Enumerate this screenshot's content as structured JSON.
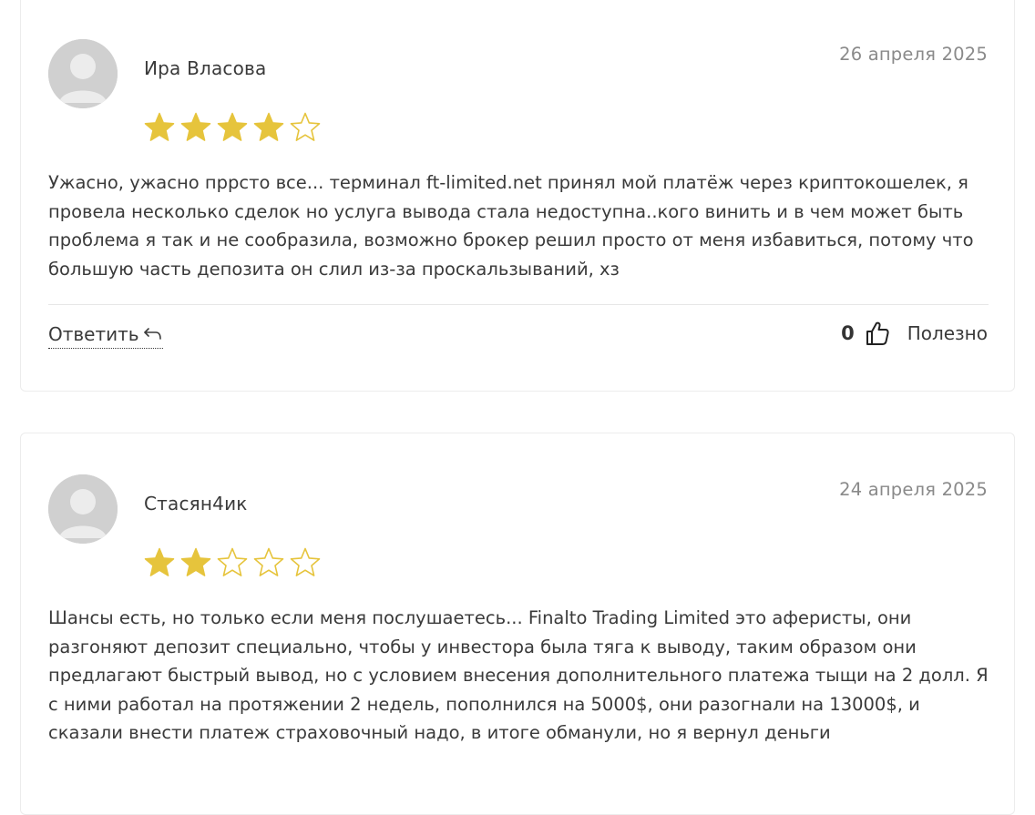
{
  "reviews": [
    {
      "author": "Ира Власова",
      "date": "26 апреля 2025",
      "rating": 4,
      "max_rating": 5,
      "text": "Ужасно, ужасно пррсто все... терминал ft-limited.net принял мой платёж через криптокошелек, я провела несколько сделок но услуга вывода стала недоступна..кого винить и в чем может быть проблема я так и не сообразила, возможно брокер решил просто от меня избавиться, потому что большую часть депозита он слил из-за проскальзываний, хз",
      "reply_label": "Ответить",
      "helpful_count": "0",
      "helpful_label": "Полезно"
    },
    {
      "author": "Стасян4ик",
      "date": "24 апреля 2025",
      "rating": 2,
      "max_rating": 5,
      "text": "Шансы есть, но только если меня послушаетесь... Finalto Trading Limited это аферисты, они разгоняют депозит специально, чтобы у инвестора была тяга к выводу, таким образом они предлагают быстрый вывод, но с условием внесения дополнительного платежа тыщи на 2 долл. Я с ними работал на протяжении 2 недель, пополнился на 5000$, они разогнали на 13000$, и сказали внести платеж страховочный надо, в итоге обманули, но я вернул деньги"
    }
  ],
  "colors": {
    "star_filled": "#e6c43c",
    "star_empty_stroke": "#e6c43c",
    "avatar_bg": "#d0d0d0"
  },
  "icons": {
    "avatar": "user-avatar-icon",
    "star": "star-icon",
    "reply": "reply-arrow-icon",
    "like": "thumbs-up-icon"
  }
}
